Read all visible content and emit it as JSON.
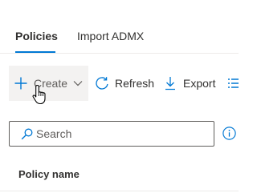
{
  "tabs": [
    {
      "label": "Policies",
      "selected": true
    },
    {
      "label": "Import ADMX",
      "selected": false
    }
  ],
  "toolbar": {
    "create": {
      "label": "Create",
      "icon": "plus-icon",
      "dropdown_icon": "chevron-down-icon"
    },
    "refresh": {
      "label": "Refresh",
      "icon": "refresh-icon"
    },
    "export": {
      "label": "Export",
      "icon": "download-icon"
    },
    "columns_icon": "columns-icon"
  },
  "search": {
    "placeholder": "Search",
    "value": "",
    "icon": "search-icon"
  },
  "info_icon": "info-icon",
  "table": {
    "columns": [
      "Policy name"
    ]
  },
  "colors": {
    "accent": "#0078d4",
    "hover_bg": "#f3f2f1",
    "text": "#323130",
    "divider": "#edebe9"
  }
}
